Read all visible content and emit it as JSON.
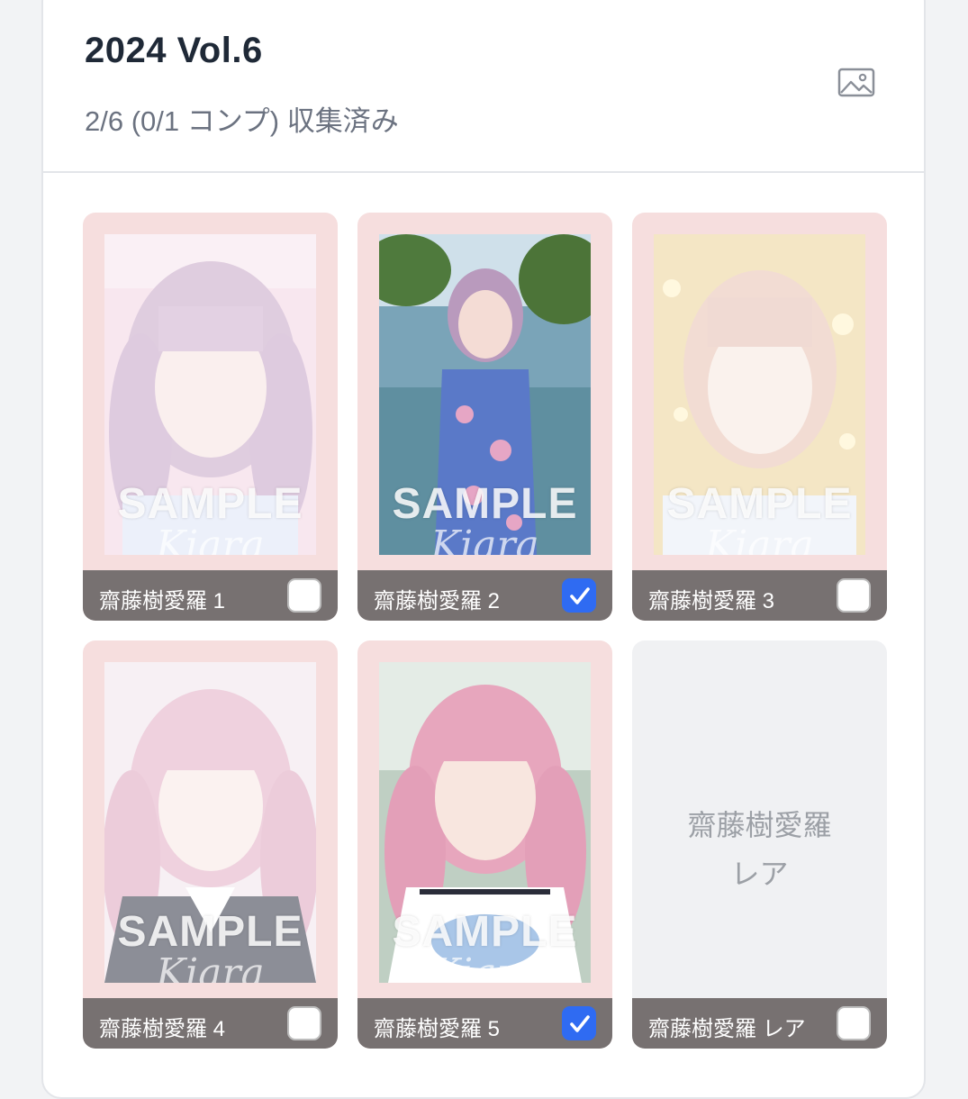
{
  "header": {
    "title": "2024 Vol.6",
    "subtitle": "2/6 (0/1 コンプ) 収集済み",
    "image_icon": "image-icon"
  },
  "cards": [
    {
      "label": "齋藤樹愛羅 1",
      "checked": false,
      "watermark": "SAMPLE",
      "signature": "Kiara",
      "dimmed": true
    },
    {
      "label": "齋藤樹愛羅 2",
      "checked": true,
      "watermark": "SAMPLE",
      "signature": "Kiara",
      "dimmed": false
    },
    {
      "label": "齋藤樹愛羅 3",
      "checked": false,
      "watermark": "SAMPLE",
      "signature": "Kiara",
      "dimmed": true
    },
    {
      "label": "齋藤樹愛羅 4",
      "checked": false,
      "watermark": "SAMPLE",
      "signature": "Kiara",
      "dimmed": true
    },
    {
      "label": "齋藤樹愛羅 5",
      "checked": true,
      "watermark": "SAMPLE",
      "signature": "Kiara",
      "dimmed": false
    },
    {
      "label": "齋藤樹愛羅 レア",
      "checked": false,
      "placeholder_line1": "齋藤樹愛羅",
      "placeholder_line2": "レア"
    }
  ],
  "colors": {
    "check_on": "#2f6bf2",
    "label_bar": "#777171",
    "card_frame": "#f6dede"
  }
}
